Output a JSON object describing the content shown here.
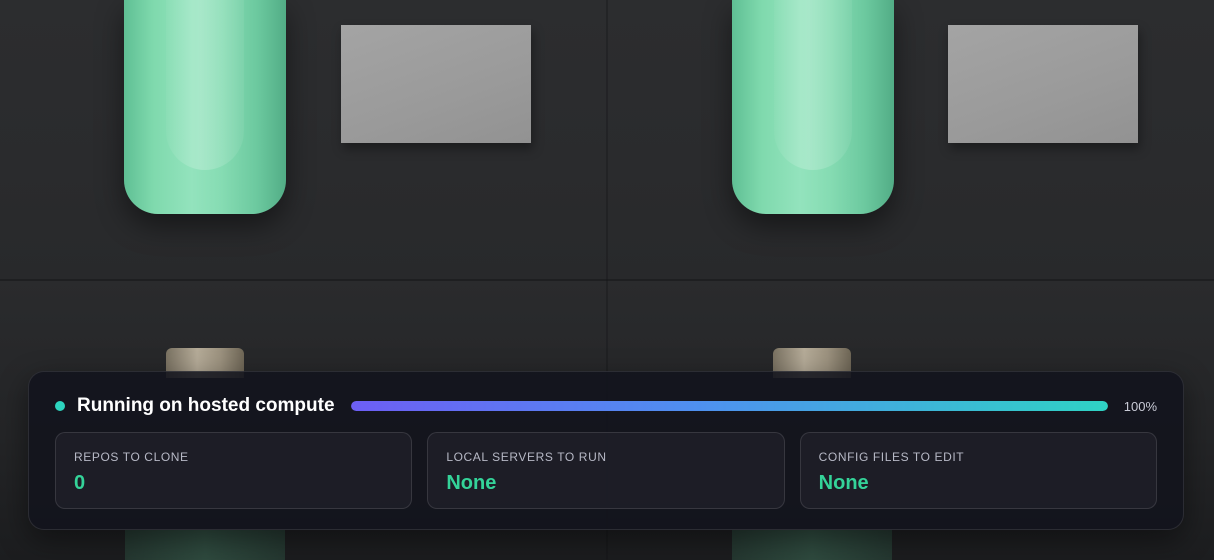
{
  "status": {
    "label": "Running on hosted compute",
    "progress_percent": 100,
    "progress_text": "100%",
    "dot_color": "#2dd4bf",
    "icon": "status-dot-icon"
  },
  "stats": [
    {
      "label": "REPOS TO CLONE",
      "value": "0"
    },
    {
      "label": "LOCAL SERVERS TO RUN",
      "value": "None"
    },
    {
      "label": "CONFIG FILES TO EDIT",
      "value": "None"
    }
  ],
  "colors": {
    "accent_green": "#34d399",
    "progress_start": "#6d5ef5",
    "progress_end": "#2fd3c4",
    "panel_bg": "#12131c"
  }
}
